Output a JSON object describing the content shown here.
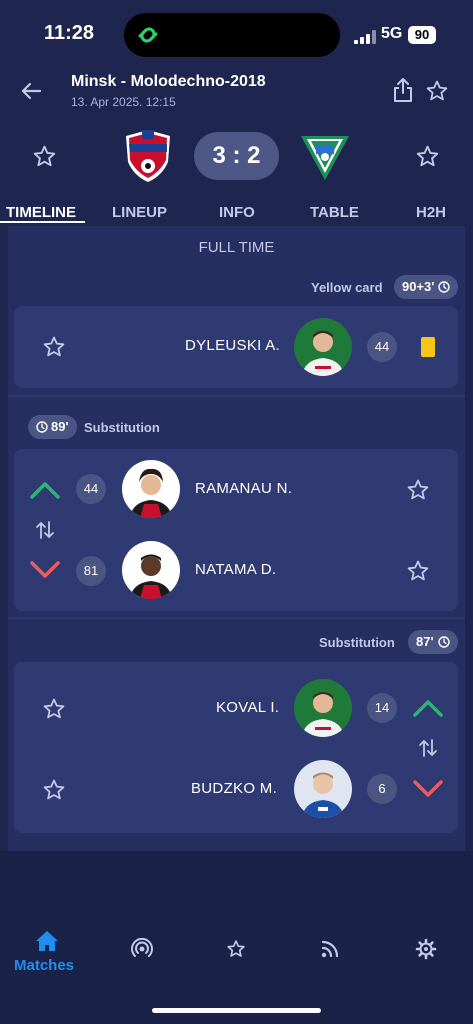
{
  "status_bar": {
    "time": "11:28",
    "network": "5G",
    "battery": "90"
  },
  "header": {
    "title": "Minsk - Molodechno-2018",
    "datetime": "13. Apr 2025. 12:15"
  },
  "match": {
    "score": "3 : 2"
  },
  "tabs": [
    "TIMELINE",
    "LINEUP",
    "INFO",
    "TABLE",
    "H2H"
  ],
  "timeline": {
    "status": "FULL TIME",
    "events": [
      {
        "type": "Yellow card",
        "minute": "90+3'",
        "player": {
          "name": "DYLEUSKI A.",
          "number": "44"
        }
      },
      {
        "type": "Substitution",
        "minute": "89'",
        "in": {
          "name": "RAMANAU N.",
          "number": "44"
        },
        "out": {
          "name": "NATAMA D.",
          "number": "81"
        }
      },
      {
        "type": "Substitution",
        "minute": "87'",
        "in": {
          "name": "KOVAL I.",
          "number": "14"
        },
        "out": {
          "name": "BUDZKO M.",
          "number": "6"
        }
      }
    ]
  },
  "bottom_nav": {
    "items": [
      {
        "label": "Matches",
        "icon": "home-icon",
        "active": true
      },
      {
        "label": "",
        "icon": "live-icon"
      },
      {
        "label": "",
        "icon": "star-icon"
      },
      {
        "label": "",
        "icon": "rss-icon"
      },
      {
        "label": "",
        "icon": "settings-icon"
      }
    ]
  },
  "colors": {
    "background": "#1e2650",
    "card": "#2f3a73",
    "accent": "#1f8ef1",
    "in": "#2bb673",
    "out": "#f05a5a",
    "yellow": "#f5c518"
  }
}
